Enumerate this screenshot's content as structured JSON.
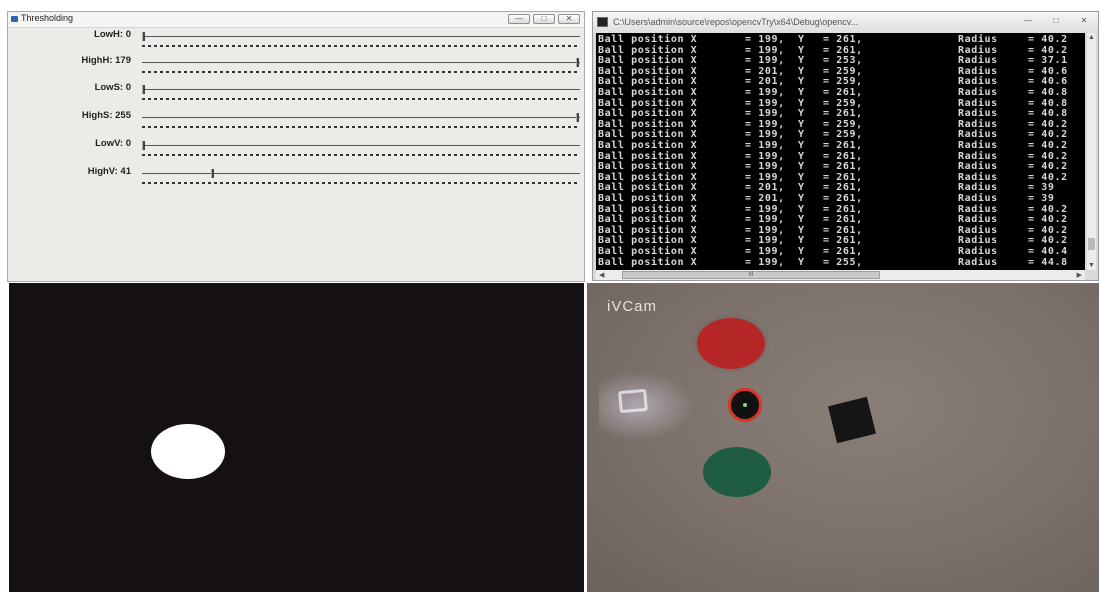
{
  "threshold_window": {
    "title": "Thresholding",
    "trackbars": [
      {
        "label": "LowH: 0",
        "fraction": 0.0
      },
      {
        "label": "HighH: 179",
        "fraction": 1.0
      },
      {
        "label": "LowS: 0",
        "fraction": 0.0
      },
      {
        "label": "HighS: 255",
        "fraction": 1.0
      },
      {
        "label": "LowV: 0",
        "fraction": 0.0
      },
      {
        "label": "HighV: 41",
        "fraction": 0.16
      }
    ]
  },
  "console_window": {
    "title": "C:\\Users\\admin\\source\\repos\\opencvTry\\x64\\Debug\\opencv...",
    "lines": [
      {
        "label": "Ball position X",
        "x": "= 199,",
        "yl": "Y",
        "y": "= 261,",
        "rl": "Radius",
        "r": "= 40.2"
      },
      {
        "label": "Ball position X",
        "x": "= 199,",
        "yl": "Y",
        "y": "= 261,",
        "rl": "Radius",
        "r": "= 40.2"
      },
      {
        "label": "Ball position X",
        "x": "= 199,",
        "yl": "Y",
        "y": "= 253,",
        "rl": "Radius",
        "r": "= 37.1"
      },
      {
        "label": "Ball position X",
        "x": "= 201,",
        "yl": "Y",
        "y": "= 259,",
        "rl": "Radius",
        "r": "= 40.6"
      },
      {
        "label": "Ball position X",
        "x": "= 201,",
        "yl": "Y",
        "y": "= 259,",
        "rl": "Radius",
        "r": "= 40.6"
      },
      {
        "label": "Ball position X",
        "x": "= 199,",
        "yl": "Y",
        "y": "= 261,",
        "rl": "Radius",
        "r": "= 40.8"
      },
      {
        "label": "Ball position X",
        "x": "= 199,",
        "yl": "Y",
        "y": "= 259,",
        "rl": "Radius",
        "r": "= 40.8"
      },
      {
        "label": "Ball position X",
        "x": "= 199,",
        "yl": "Y",
        "y": "= 261,",
        "rl": "Radius",
        "r": "= 40.8"
      },
      {
        "label": "Ball position X",
        "x": "= 199,",
        "yl": "Y",
        "y": "= 259,",
        "rl": "Radius",
        "r": "= 40.2"
      },
      {
        "label": "Ball position X",
        "x": "= 199,",
        "yl": "Y",
        "y": "= 259,",
        "rl": "Radius",
        "r": "= 40.2"
      },
      {
        "label": "Ball position X",
        "x": "= 199,",
        "yl": "Y",
        "y": "= 261,",
        "rl": "Radius",
        "r": "= 40.2"
      },
      {
        "label": "Ball position X",
        "x": "= 199,",
        "yl": "Y",
        "y": "= 261,",
        "rl": "Radius",
        "r": "= 40.2"
      },
      {
        "label": "Ball position X",
        "x": "= 199,",
        "yl": "Y",
        "y": "= 261,",
        "rl": "Radius",
        "r": "= 40.2"
      },
      {
        "label": "Ball position X",
        "x": "= 199,",
        "yl": "Y",
        "y": "= 261,",
        "rl": "Radius",
        "r": "= 40.2"
      },
      {
        "label": "Ball position X",
        "x": "= 201,",
        "yl": "Y",
        "y": "= 261,",
        "rl": "Radius",
        "r": "= 39"
      },
      {
        "label": "Ball position X",
        "x": "= 201,",
        "yl": "Y",
        "y": "= 261,",
        "rl": "Radius",
        "r": "= 39"
      },
      {
        "label": "Ball position X",
        "x": "= 199,",
        "yl": "Y",
        "y": "= 261,",
        "rl": "Radius",
        "r": "= 40.2"
      },
      {
        "label": "Ball position X",
        "x": "= 199,",
        "yl": "Y",
        "y": "= 261,",
        "rl": "Radius",
        "r": "= 40.2"
      },
      {
        "label": "Ball position X",
        "x": "= 199,",
        "yl": "Y",
        "y": "= 261,",
        "rl": "Radius",
        "r": "= 40.2"
      },
      {
        "label": "Ball position X",
        "x": "= 199,",
        "yl": "Y",
        "y": "= 261,",
        "rl": "Radius",
        "r": "= 40.2"
      },
      {
        "label": "Ball position X",
        "x": "= 199,",
        "yl": "Y",
        "y": "= 261,",
        "rl": "Radius",
        "r": "= 40.4"
      },
      {
        "label": "Ball position X",
        "x": "= 199,",
        "yl": "Y",
        "y": "= 255,",
        "rl": "Radius",
        "r": "= 44.8"
      }
    ],
    "scroll_thumb_text": "III"
  },
  "camera_view": {
    "label": "iVCam"
  },
  "colors": {
    "threshold_background": "#151014",
    "detected_blob": "#ffffff",
    "red_ball": "#b52626",
    "green_ball": "#1e5c44",
    "tracking_circle": "#d73328",
    "tracking_center": "#6fe07a",
    "console_text": "#d8d8d8"
  },
  "icons": {
    "minimize": "minimize-icon",
    "maximize": "maximize-icon",
    "close": "close-icon"
  }
}
